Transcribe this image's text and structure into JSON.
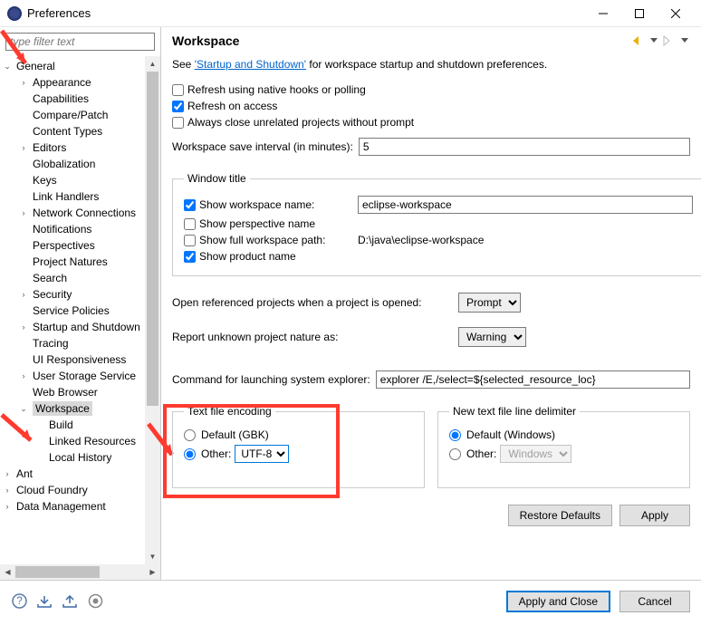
{
  "window": {
    "title": "Preferences"
  },
  "filter": {
    "placeholder": "type filter text"
  },
  "tree": [
    {
      "label": "General",
      "depth": 1,
      "exp": "v"
    },
    {
      "label": "Appearance",
      "depth": 2,
      "exp": ">"
    },
    {
      "label": "Capabilities",
      "depth": 2
    },
    {
      "label": "Compare/Patch",
      "depth": 2
    },
    {
      "label": "Content Types",
      "depth": 2
    },
    {
      "label": "Editors",
      "depth": 2,
      "exp": ">"
    },
    {
      "label": "Globalization",
      "depth": 2
    },
    {
      "label": "Keys",
      "depth": 2
    },
    {
      "label": "Link Handlers",
      "depth": 2
    },
    {
      "label": "Network Connections",
      "depth": 2,
      "exp": ">"
    },
    {
      "label": "Notifications",
      "depth": 2
    },
    {
      "label": "Perspectives",
      "depth": 2
    },
    {
      "label": "Project Natures",
      "depth": 2
    },
    {
      "label": "Search",
      "depth": 2
    },
    {
      "label": "Security",
      "depth": 2,
      "exp": ">"
    },
    {
      "label": "Service Policies",
      "depth": 2
    },
    {
      "label": "Startup and Shutdown",
      "depth": 2,
      "exp": ">"
    },
    {
      "label": "Tracing",
      "depth": 2
    },
    {
      "label": "UI Responsiveness",
      "depth": 2
    },
    {
      "label": "User Storage Service",
      "depth": 2,
      "exp": ">"
    },
    {
      "label": "Web Browser",
      "depth": 2
    },
    {
      "label": "Workspace",
      "depth": 2,
      "exp": "v",
      "selected": true
    },
    {
      "label": "Build",
      "depth": 3
    },
    {
      "label": "Linked Resources",
      "depth": 3
    },
    {
      "label": "Local History",
      "depth": 3
    },
    {
      "label": "Ant",
      "depth": 1,
      "exp": ">"
    },
    {
      "label": "Cloud Foundry",
      "depth": 1,
      "exp": ">"
    },
    {
      "label": "Data Management",
      "depth": 1,
      "exp": ">"
    }
  ],
  "page": {
    "title": "Workspace",
    "intro_pre": "See ",
    "intro_link": "'Startup and Shutdown'",
    "intro_post": " for workspace startup and shutdown preferences.",
    "chk_refresh_native": "Refresh using native hooks or polling",
    "chk_refresh_access": "Refresh on access",
    "chk_close_unrelated": "Always close unrelated projects without prompt",
    "save_interval_label": "Workspace save interval (in minutes):",
    "save_interval_value": "5",
    "wt_legend": "Window title",
    "wt_show_ws": "Show workspace name:",
    "wt_ws_value": "eclipse-workspace",
    "wt_show_persp": "Show perspective name",
    "wt_show_path": "Show full workspace path:",
    "wt_path_value": "D:\\java\\eclipse-workspace",
    "wt_show_product": "Show product name",
    "open_ref_label": "Open referenced projects when a project is opened:",
    "open_ref_value": "Prompt",
    "report_unknown_label": "Report unknown project nature as:",
    "report_unknown_value": "Warning",
    "sysexplorer_label": "Command for launching system explorer:",
    "sysexplorer_value": "explorer /E,/select=${selected_resource_loc}",
    "enc_legend": "Text file encoding",
    "enc_default": "Default (GBK)",
    "enc_other": "Other:",
    "enc_other_value": "UTF-8",
    "delim_legend": "New text file line delimiter",
    "delim_default": "Default (Windows)",
    "delim_other": "Other:",
    "delim_other_value": "Windows",
    "restore": "Restore Defaults",
    "apply": "Apply"
  },
  "footer": {
    "apply_close": "Apply and Close",
    "cancel": "Cancel"
  }
}
